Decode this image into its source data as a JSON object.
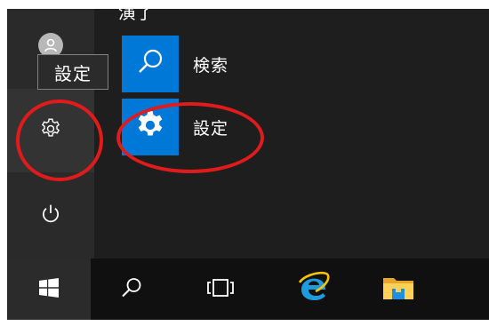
{
  "start_menu": {
    "cut_label": "演了",
    "tooltip": "設定",
    "apps": [
      {
        "label": "検索",
        "icon": "search-icon"
      },
      {
        "label": "設定",
        "icon": "gear-icon"
      }
    ],
    "rail": [
      "user-icon",
      "gear-icon",
      "power-icon"
    ]
  },
  "taskbar": {
    "items": [
      "windows-logo-icon",
      "search-icon",
      "task-view-icon",
      "internet-explorer-icon",
      "file-explorer-icon"
    ]
  },
  "annotations": {
    "ring_color": "#e01b1b",
    "rings": [
      "rail-settings",
      "app-settings"
    ]
  },
  "colors": {
    "tile": "#0078d7",
    "menu_bg": "#1e1e1e",
    "taskbar_bg": "#101010"
  }
}
